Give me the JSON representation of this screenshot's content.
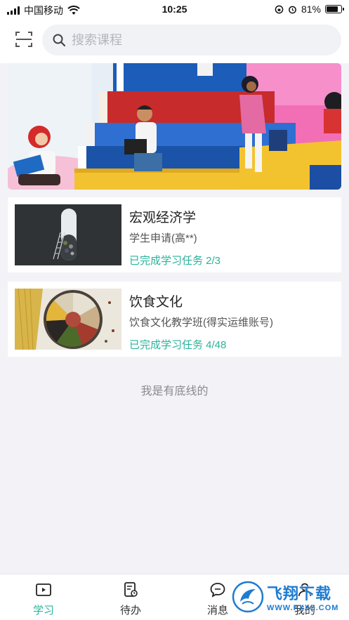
{
  "status_bar": {
    "carrier": "中国移动",
    "time": "10:25",
    "battery": "81%",
    "battery_level": 0.81
  },
  "search": {
    "placeholder": "搜索课程"
  },
  "banner": {
    "icon": "reading-students-illustration"
  },
  "courses": [
    {
      "title": "宏观经济学",
      "subtitle": "学生申请(高**)",
      "progress": "已完成学习任务 2/3"
    },
    {
      "title": "饮食文化",
      "subtitle": "饮食文化教学班(得实运维账号)",
      "progress": "已完成学习任务 4/48"
    }
  ],
  "footer_note": "我是有底线的",
  "tabs": [
    {
      "label": "学习",
      "icon": "play-icon",
      "active": true
    },
    {
      "label": "待办",
      "icon": "todo-icon",
      "active": false
    },
    {
      "label": "消息",
      "icon": "message-icon",
      "active": false
    },
    {
      "label": "我的",
      "icon": "profile-icon",
      "active": false
    }
  ],
  "watermark": {
    "main": "飞翔下载",
    "url": "WWW.FXXZ.COM"
  },
  "colors": {
    "accent": "#2ab39b",
    "background": "#f3f3f7",
    "watermark": "#1e7bd0"
  }
}
